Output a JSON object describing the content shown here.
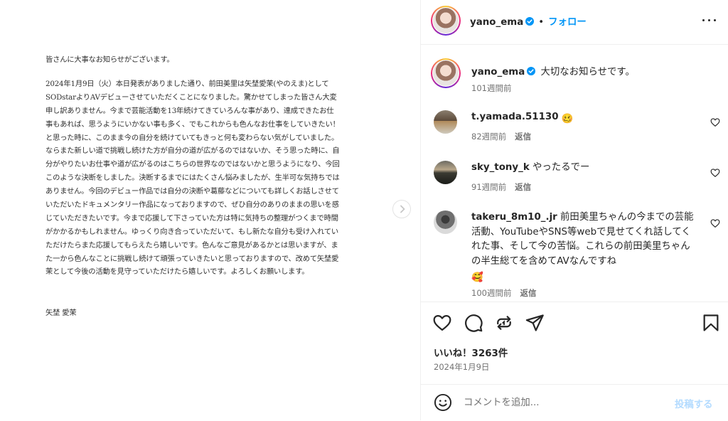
{
  "letter": {
    "greeting": "皆さんに大事なお知らせがございます。",
    "lines": [
      "2024年1月9日（火）本日発表がありました通り、前田美里は矢埜愛茉(やのえま)として",
      "SODstarよりAVデビューさせていただくことになりました。驚かせてしまった皆さん大変",
      "申し訳ありません。今まで芸能活動を13年続けてきていろんな事があり、達成できたお仕",
      "事もあれば、思うようにいかない事も多く、でもこれからも色んなお仕事をしていきたい！",
      "と思った時に、このまま今の自分を続けていてもきっと何も変わらない気がしていました。",
      "ならまた新しい道で挑戦し続けた方が自分の道が広がるのではないか、そう思った時に、自",
      "分がやりたいお仕事や道が広がるのはこちらの世界なのではないかと思うようになり、今回",
      "このような決断をしました。決断するまでにはたくさん悩みましたが、生半可な気持ちでは",
      "ありません。今回のデビュー作品では自分の決断や葛藤などについても詳しくお話しさせて",
      "いただいたドキュメンタリー作品になっておりますので、ぜひ自分のありのままの思いを感",
      "じていただきたいです。今まで応援して下さっていた方は特に気持ちの整理がつくまで時間",
      "がかかるかもしれません。ゆっくり向き合っていただいて、もし新たな自分も受け入れてい",
      "ただけたらまた応援してもらえたら嬉しいです。色んなご意見があるかとは思いますが、ま",
      "た一から色んなことに挑戦し続けて頑張っていきたいと思っておりますので、改めて矢埜愛",
      "茉として今後の活動を見守っていただけたら嬉しいです。よろしくお願いします。"
    ],
    "signature": "矢埜 愛茉"
  },
  "header": {
    "username": "yano_ema",
    "separator": "•",
    "follow_label": "フォロー"
  },
  "caption": {
    "username": "yano_ema",
    "text": "大切なお知らせです。",
    "time": "101週間前"
  },
  "comments": [
    {
      "username": "t.yamada.51130",
      "text": "🥴",
      "time": "82週間前",
      "reply_label": "返信"
    },
    {
      "username": "sky_tony_k",
      "text": "やったるでー",
      "time": "91週間前",
      "reply_label": "返信"
    },
    {
      "username": "takeru_8m10_.jr",
      "text": "前田美里ちゃんの今までの芸能活動、YouTubeやSNS等webで見せてくれ話してくれた事、そして今の苦悩。これらの前田美里ちゃんの半生総てを含めてAVなんですね",
      "emoji": "🥰",
      "time": "100週間前",
      "reply_label": "返信"
    }
  ],
  "likes": "いいね！3263件",
  "date": "2024年1月9日",
  "comment_box": {
    "placeholder": "コメントを追加...",
    "post_label": "投稿する"
  },
  "colors": {
    "link_blue": "#0095f6",
    "post_disabled": "#b3dbff",
    "muted_text": "#737373"
  },
  "icons": [
    "chevron-right-icon",
    "verified-badge-icon",
    "more-options-icon",
    "heart-icon",
    "comment-icon",
    "repost-icon",
    "share-icon",
    "bookmark-icon",
    "emoji-icon"
  ]
}
